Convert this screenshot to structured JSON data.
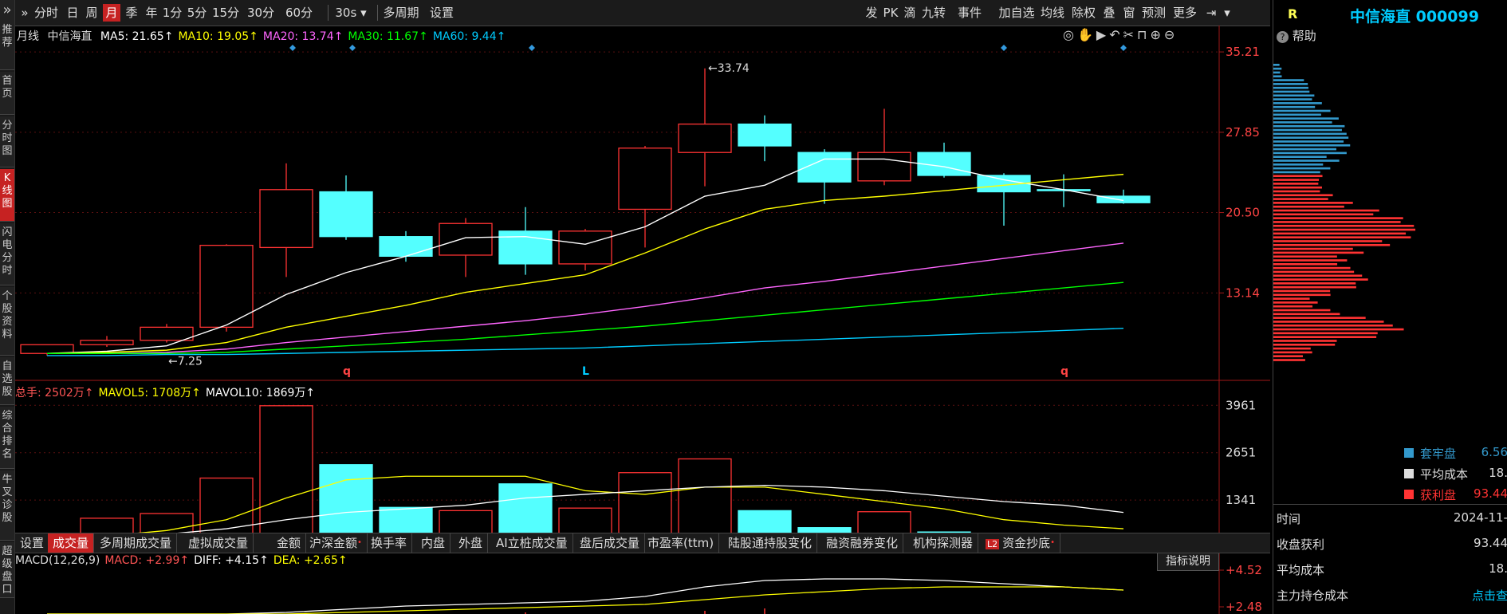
{
  "left_nav": [
    {
      "label": "推荐",
      "chars": [
        "推",
        "荐"
      ]
    },
    {
      "label": "首页",
      "chars": [
        "首",
        "页"
      ]
    },
    {
      "label": "分时图",
      "chars": [
        "分",
        "时",
        "图"
      ]
    },
    {
      "label": "K线图",
      "chars": [
        "K",
        "线",
        "图"
      ]
    },
    {
      "label": "闪电分时",
      "chars": [
        "闪",
        "电",
        "分",
        "时"
      ]
    },
    {
      "label": "个股资料",
      "chars": [
        "个",
        "股",
        "资",
        "料"
      ]
    },
    {
      "label": "自选股",
      "chars": [
        "自",
        "选",
        "股"
      ]
    },
    {
      "label": "综合排名",
      "chars": [
        "综",
        "合",
        "排",
        "名"
      ]
    },
    {
      "label": "牛叉诊股",
      "chars": [
        "牛",
        "叉",
        "诊",
        "股"
      ]
    },
    {
      "label": "超级盘口",
      "chars": [
        "超",
        "级",
        "盘",
        "口"
      ]
    }
  ],
  "left_nav_active": 3,
  "toolbar": {
    "expand_icon": "double-chevron-right-icon",
    "periods": [
      "分时",
      "日",
      "周",
      "月",
      "季",
      "年",
      "1分",
      "5分",
      "15分",
      "30分",
      "60分"
    ],
    "active_period": "月",
    "secs": "30s",
    "multi_period": "多周期",
    "settings": "设置",
    "right_items": [
      "发",
      "PK",
      "滴",
      "九转",
      "事件",
      "加自选",
      "均线",
      "除权",
      "叠",
      "窗",
      "预测",
      "更多"
    ]
  },
  "chart": {
    "period_label": "月线",
    "stock_name": "中信海直",
    "ma": [
      {
        "label": "MA5: 21.65↑",
        "color": "#ffffff"
      },
      {
        "label": "MA10: 19.05↑",
        "color": "#ffff00"
      },
      {
        "label": "MA20: 13.74↑",
        "color": "#ff66ff"
      },
      {
        "label": "MA30: 11.67↑",
        "color": "#00ff00"
      },
      {
        "label": "MA60: 9.44↑",
        "color": "#00ccff"
      }
    ],
    "price_ticks": [
      "35.21",
      "27.85",
      "20.50",
      "13.14"
    ],
    "high_label": "33.74",
    "low_label": "7.25",
    "markers": [
      "q",
      "L",
      "q"
    ],
    "candles": [
      {
        "o": 7.6,
        "c": 8.4,
        "h": 8.4,
        "l": 7.4,
        "up": true
      },
      {
        "o": 8.4,
        "c": 8.8,
        "h": 9.2,
        "l": 8.2,
        "up": true
      },
      {
        "o": 8.8,
        "c": 10.0,
        "h": 10.3,
        "l": 8.6,
        "up": true
      },
      {
        "o": 10.0,
        "c": 17.5,
        "h": 17.6,
        "l": 9.6,
        "up": true
      },
      {
        "o": 17.3,
        "c": 22.6,
        "h": 25.0,
        "l": 14.6,
        "up": true
      },
      {
        "o": 22.4,
        "c": 18.3,
        "h": 23.9,
        "l": 18.0,
        "up": false
      },
      {
        "o": 18.3,
        "c": 16.5,
        "h": 18.8,
        "l": 16.0,
        "up": false
      },
      {
        "o": 16.6,
        "c": 19.5,
        "h": 20.0,
        "l": 14.6,
        "up": true
      },
      {
        "o": 18.8,
        "c": 15.8,
        "h": 21.0,
        "l": 14.8,
        "up": false
      },
      {
        "o": 15.8,
        "c": 18.8,
        "h": 19.0,
        "l": 15.2,
        "up": true
      },
      {
        "o": 20.8,
        "c": 26.4,
        "h": 26.6,
        "l": 17.3,
        "up": true
      },
      {
        "o": 26.0,
        "c": 28.6,
        "h": 33.7,
        "l": 22.9,
        "up": true
      },
      {
        "o": 28.6,
        "c": 26.6,
        "h": 29.4,
        "l": 25.2,
        "up": false
      },
      {
        "o": 26.0,
        "c": 23.3,
        "h": 26.3,
        "l": 21.3,
        "up": false
      },
      {
        "o": 23.4,
        "c": 26.0,
        "h": 30.0,
        "l": 23.0,
        "up": true
      },
      {
        "o": 26.0,
        "c": 23.9,
        "h": 26.9,
        "l": 23.7,
        "up": false
      },
      {
        "o": 23.9,
        "c": 22.4,
        "h": 24.1,
        "l": 19.3,
        "up": false
      },
      {
        "o": 22.6,
        "c": 22.5,
        "h": 24.0,
        "l": 21.0,
        "up": false
      },
      {
        "o": 22.0,
        "c": 21.4,
        "h": 22.6,
        "l": 21.3,
        "up": false
      }
    ],
    "ma_lines": {
      "ma5": [
        7.6,
        7.8,
        8.3,
        10.2,
        13.0,
        15.0,
        16.5,
        18.2,
        18.3,
        17.6,
        19.2,
        22.0,
        23.0,
        25.4,
        25.4,
        24.7,
        23.5,
        22.6,
        21.6
      ],
      "ma10": [
        7.6,
        7.7,
        7.9,
        8.6,
        10.0,
        11.0,
        12.0,
        13.2,
        14.0,
        14.8,
        16.8,
        19.0,
        20.8,
        21.6,
        22.0,
        22.5,
        23.0,
        23.5,
        24.0
      ],
      "ma20": [
        7.6,
        7.6,
        7.7,
        8.0,
        8.6,
        9.1,
        9.6,
        10.1,
        10.6,
        11.2,
        11.9,
        12.7,
        13.6,
        14.2,
        14.9,
        15.6,
        16.3,
        17.0,
        17.7
      ],
      "ma30": [
        7.6,
        7.6,
        7.6,
        7.7,
        8.0,
        8.3,
        8.6,
        8.9,
        9.3,
        9.7,
        10.1,
        10.6,
        11.1,
        11.6,
        12.1,
        12.6,
        13.1,
        13.6,
        14.1
      ],
      "ma60": [
        7.4,
        7.4,
        7.5,
        7.5,
        7.6,
        7.7,
        7.8,
        7.9,
        8.0,
        8.1,
        8.3,
        8.5,
        8.7,
        8.9,
        9.1,
        9.3,
        9.5,
        9.7,
        9.9
      ]
    }
  },
  "volume": {
    "legend": [
      {
        "label": "总手: 2502万↑",
        "color": "#ff5555"
      },
      {
        "label": "MAVOL5: 1708万↑",
        "color": "#ffff00"
      },
      {
        "label": "MAVOL10: 1869万↑",
        "color": "#ffffff"
      }
    ],
    "ticks": [
      "3961",
      "2651",
      "1341"
    ],
    "unit": "万",
    "bars": [
      250,
      840,
      970,
      1950,
      3950,
      2320,
      1140,
      1050,
      1790,
      1120,
      2100,
      2480,
      1050,
      580,
      1020,
      460,
      420,
      370,
      190
    ],
    "mavol5": [
      300,
      350,
      500,
      800,
      1400,
      1900,
      2000,
      2000,
      2000,
      1600,
      1500,
      1700,
      1700,
      1500,
      1300,
      1100,
      800,
      650,
      550
    ],
    "mavol10": [
      300,
      350,
      400,
      550,
      800,
      1000,
      1100,
      1200,
      1400,
      1500,
      1600,
      1700,
      1750,
      1700,
      1600,
      1450,
      1300,
      1200,
      1000
    ]
  },
  "indicator_tabs": [
    {
      "label": "设置",
      "dot": false
    },
    {
      "label": "成交量",
      "dot": false
    },
    {
      "label": "多周期成交量",
      "dot": false
    },
    {
      "label": "虚拟成交量",
      "dot": false
    },
    {
      "label": "金额",
      "dot": false
    },
    {
      "label": "沪深金额",
      "dot": true
    },
    {
      "label": "换手率",
      "dot": false
    },
    {
      "label": "内盘",
      "dot": false
    },
    {
      "label": "外盘",
      "dot": false
    },
    {
      "label": "AI立桩成交量",
      "dot": false
    },
    {
      "label": "盘后成交量",
      "dot": false
    },
    {
      "label": "市盈率(ttm)",
      "dot": false
    },
    {
      "label": "陆股通持股变化",
      "dot": false
    },
    {
      "label": "融资融券变化",
      "dot": false
    },
    {
      "label": "机构探测器",
      "dot": false
    },
    {
      "label": "资金抄底",
      "dot": true,
      "badge": "L2"
    }
  ],
  "indicator_active": "成交量",
  "macd": {
    "legend": [
      {
        "label": "MACD(12,26,9)",
        "color": "#dddddd"
      },
      {
        "label": "MACD: +2.99↑",
        "color": "#ff5555"
      },
      {
        "label": "DIFF: +4.15↑",
        "color": "#ffffff"
      },
      {
        "label": "DEA: +2.65↑",
        "color": "#ffff00"
      }
    ],
    "explain_button": "指标说明",
    "ticks": [
      "+4.52",
      "+2.48"
    ]
  },
  "right_panel": {
    "r_label": "R",
    "title": "中信海直 000099",
    "help": "帮助",
    "help_icon": "question-circle-icon",
    "legend": [
      {
        "label": "套牢盘",
        "value": "6.56",
        "color": "#3399cc"
      },
      {
        "label": "平均成本",
        "value": "18.",
        "color": "#dddddd"
      },
      {
        "label": "获利盘",
        "value": "93.44",
        "color": "#ff3333"
      }
    ],
    "rows": [
      {
        "key": "时间",
        "value": "2024-11-"
      },
      {
        "key": "收盘获利",
        "value": "93.44"
      },
      {
        "key": "平均成本",
        "value": "18."
      },
      {
        "key": "主力持仓成本",
        "value": "点击查"
      }
    ],
    "colors": {
      "profit": "#ff3333",
      "trapped": "#3399cc",
      "link": "#00ccff"
    }
  },
  "colors": {
    "up": "#ff3333",
    "down": "#54ffff",
    "accent": "#c62222",
    "title": "#00ccff"
  }
}
